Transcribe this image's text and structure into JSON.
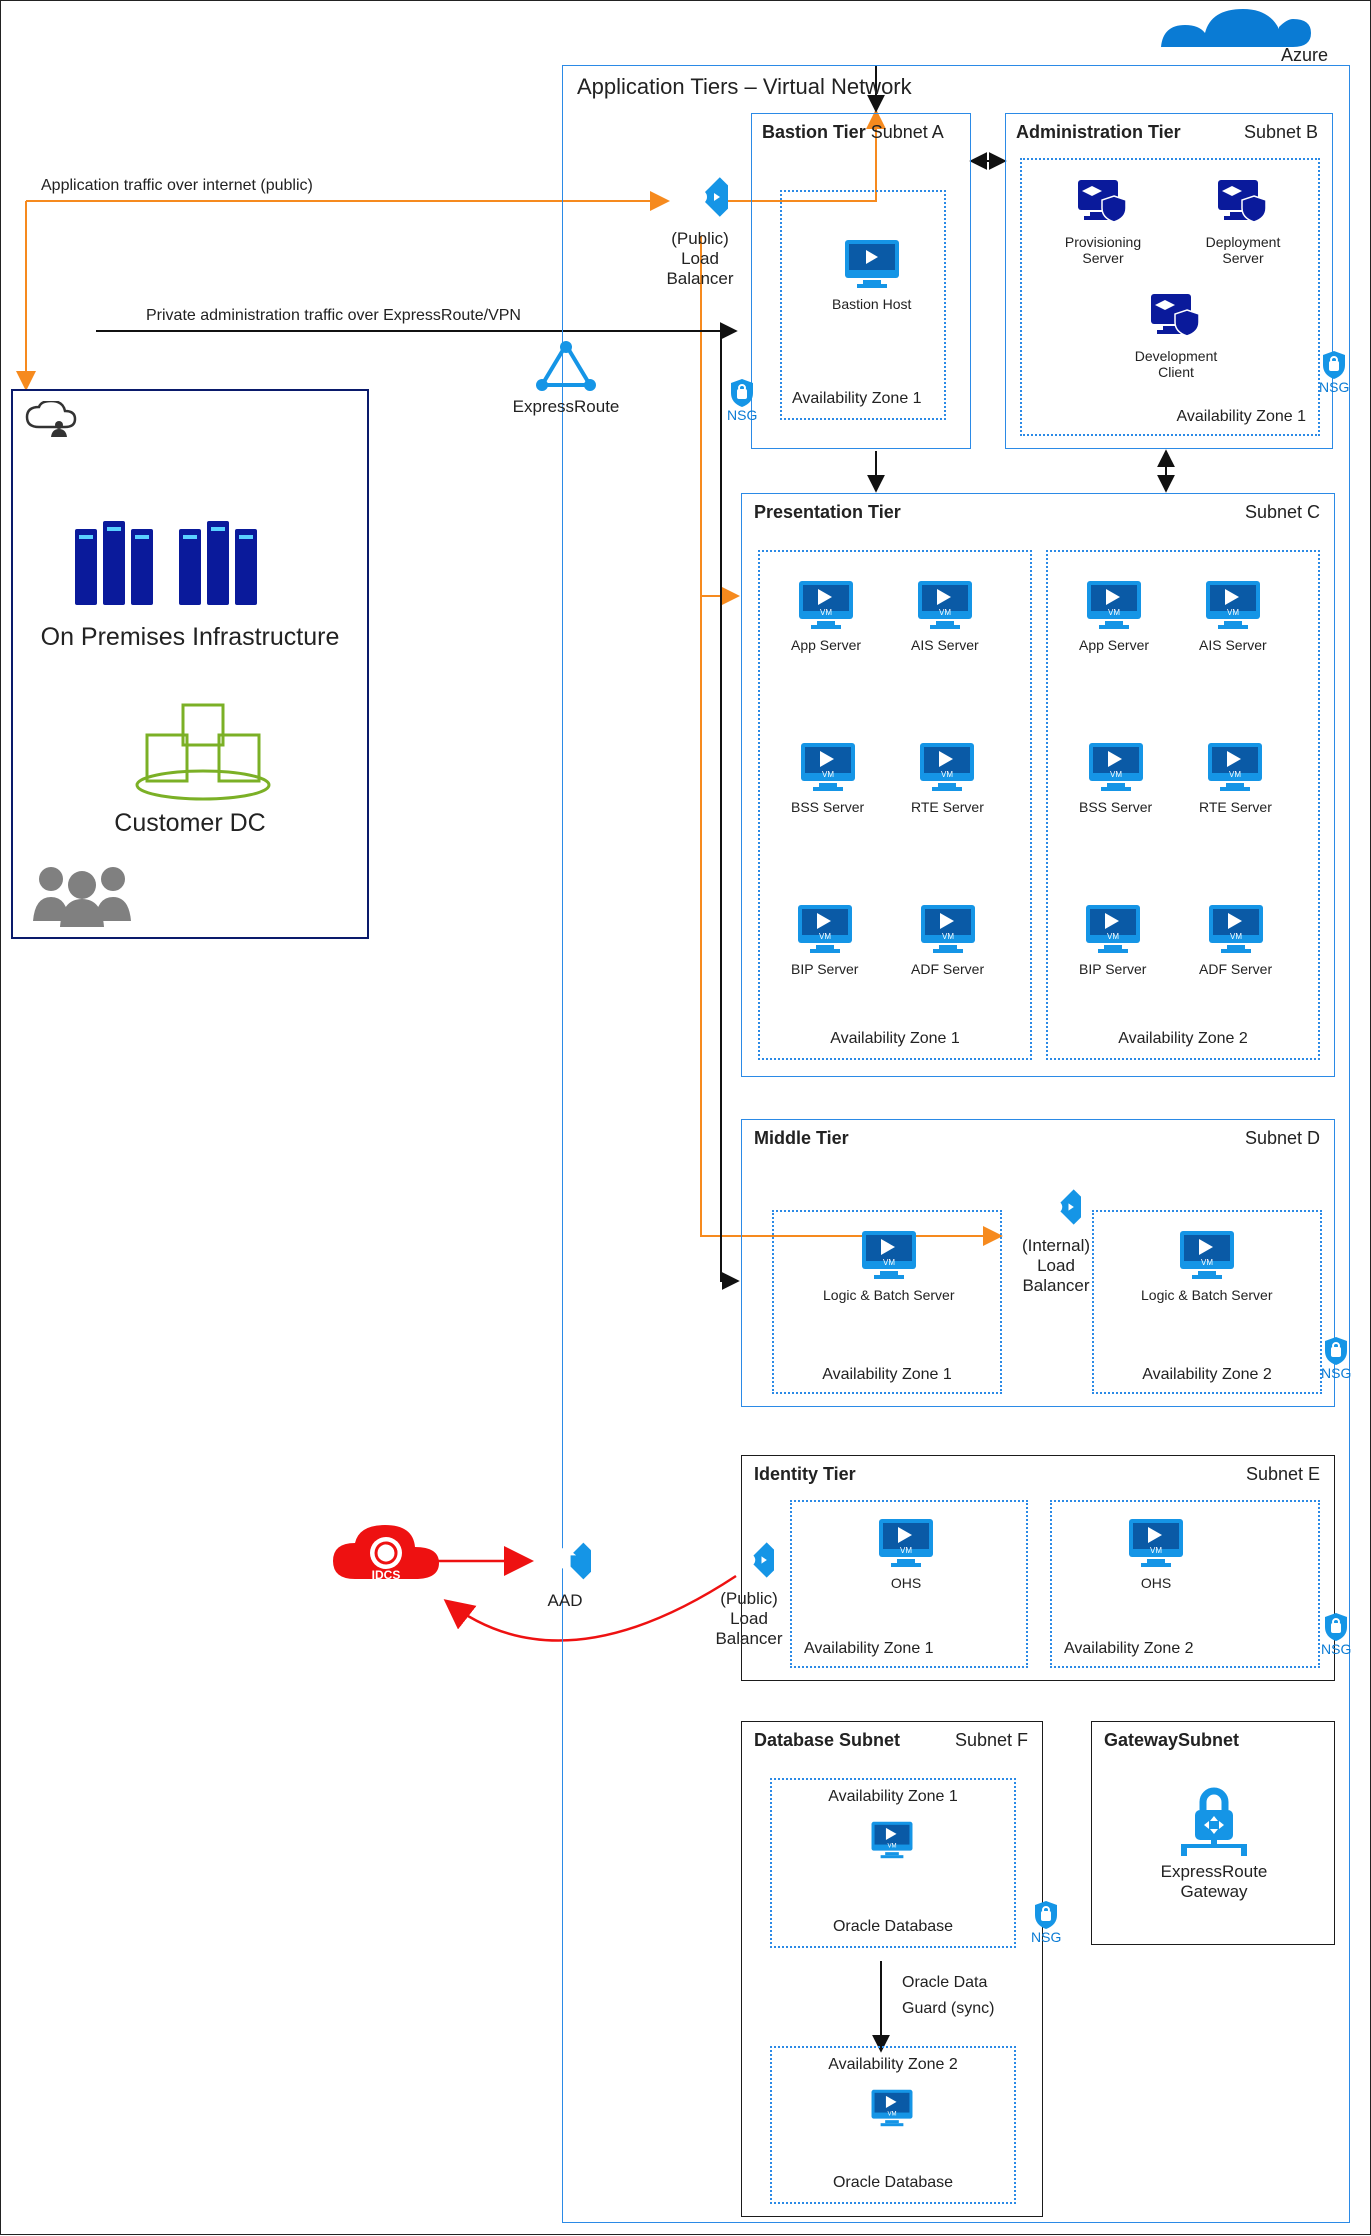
{
  "cloud": {
    "name": "Azure"
  },
  "vnet": {
    "title": "Application Tiers – Virtual Network"
  },
  "flows": {
    "publicTraffic": "Application traffic over internet (public)",
    "privateAdmin": "Private administration traffic over ExpressRoute/VPN"
  },
  "onprem": {
    "infra": "On Premises Infrastructure",
    "dc": "Customer DC"
  },
  "network": {
    "publicLB": "(Public)\nLoad Balancer",
    "expressRoute": "ExpressRoute",
    "internalLB": "(Internal)\nLoad Balancer",
    "publicLB2": "(Public)\nLoad Balancer",
    "aad": "AAD",
    "idcs": "IDCS",
    "erGateway": "ExpressRoute Gateway",
    "nsg": "NSG"
  },
  "tiers": {
    "bastion": {
      "title": "Bastion Tier",
      "subnet": "Subnet A",
      "az1": "Availability Zone 1",
      "host": "Bastion Host"
    },
    "admin": {
      "title": "Administration Tier",
      "subnet": "Subnet B",
      "az1": "Availability Zone 1",
      "prov": "Provisioning Server",
      "deploy": "Deployment Server",
      "dev": "Development Client"
    },
    "presentation": {
      "title": "Presentation Tier",
      "subnet": "Subnet C",
      "az1": "Availability Zone 1",
      "az2": "Availability Zone 2",
      "app": "App Server",
      "ais": "AIS Server",
      "bss": "BSS Server",
      "rte": "RTE Server",
      "bip": "BIP Server",
      "adf": "ADF Server"
    },
    "middle": {
      "title": "Middle Tier",
      "subnet": "Subnet D",
      "az1": "Availability Zone 1",
      "az2": "Availability Zone 2",
      "logic": "Logic & Batch Server"
    },
    "identity": {
      "title": "Identity Tier",
      "subnet": "Subnet E",
      "az1": "Availability Zone 1",
      "az2": "Availability Zone 2",
      "ohs": "OHS"
    },
    "db": {
      "title": "Database Subnet",
      "subnet": "Subnet F",
      "az1": "Availability Zone 1",
      "az2": "Availability Zone 2",
      "oracle": "Oracle Database",
      "guard1": "Oracle Data",
      "guard2": "Guard (sync)"
    },
    "gateway": {
      "title": "GatewaySubnet"
    }
  },
  "iconWord": {
    "vm": "VM"
  }
}
